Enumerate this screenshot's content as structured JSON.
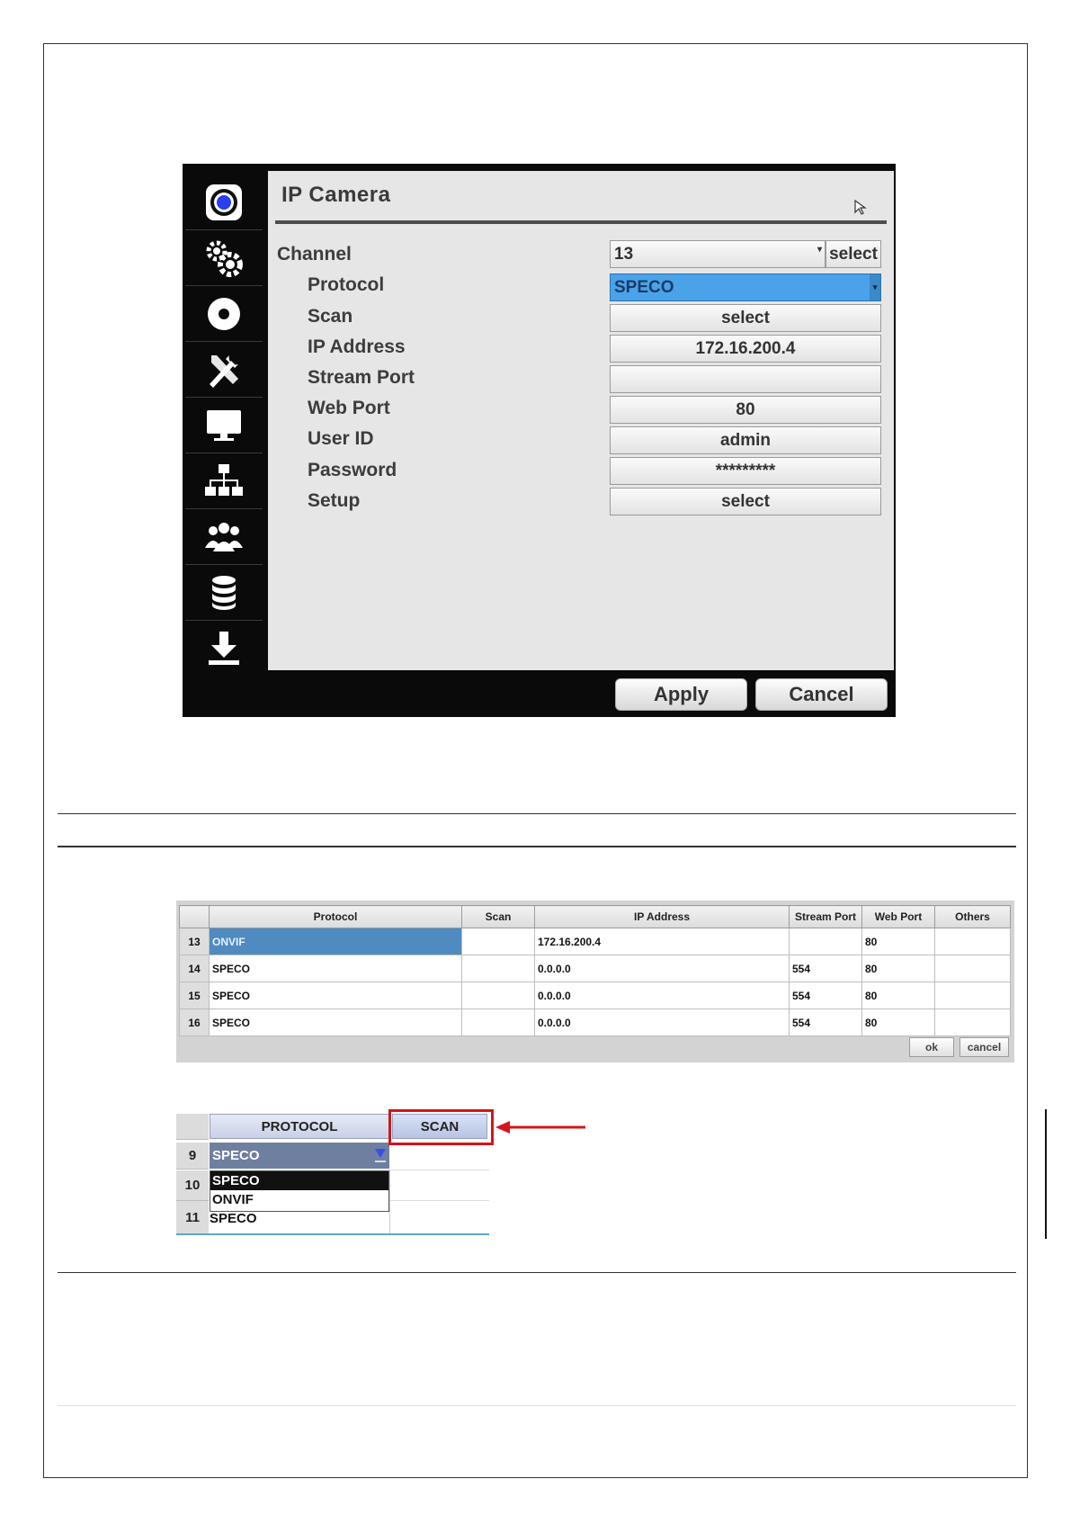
{
  "dialog": {
    "title": "IP Camera",
    "sidebar_icons": [
      "camera-icon",
      "gears-icon",
      "record-disc-icon",
      "tools-icon",
      "monitor-icon",
      "network-icon",
      "users-icon",
      "database-icon",
      "download-icon"
    ],
    "channel": {
      "label": "Channel",
      "value": "13",
      "button": "select"
    },
    "fields": [
      {
        "label": "Protocol",
        "value": "SPECO"
      },
      {
        "label": "Scan",
        "value": "select"
      },
      {
        "label": "IP  Address",
        "value": "172.16.200.4"
      },
      {
        "label": "Stream  Port",
        "value": ""
      },
      {
        "label": "Web  Port",
        "value": "80"
      },
      {
        "label": "User  ID",
        "value": "admin"
      },
      {
        "label": "Password",
        "value": "*********"
      },
      {
        "label": "Setup",
        "value": "select"
      }
    ],
    "apply": "Apply",
    "cancel": "Cancel"
  },
  "table": {
    "headers": [
      "",
      "Protocol",
      "Scan",
      "IP  Address",
      "Stream  Port",
      "Web  Port",
      "Others"
    ],
    "rows": [
      {
        "num": "13",
        "protocol": "ONVIF",
        "scan": "",
        "ip": "172.16.200.4",
        "stream": "",
        "web": "80",
        "others": ""
      },
      {
        "num": "14",
        "protocol": "SPECO",
        "scan": "",
        "ip": "0.0.0.0",
        "stream": "554",
        "web": "80",
        "others": ""
      },
      {
        "num": "15",
        "protocol": "SPECO",
        "scan": "",
        "ip": "0.0.0.0",
        "stream": "554",
        "web": "80",
        "others": ""
      },
      {
        "num": "16",
        "protocol": "SPECO",
        "scan": "",
        "ip": "0.0.0.0",
        "stream": "554",
        "web": "80",
        "others": ""
      }
    ],
    "ok": "ok",
    "cancel": "cancel"
  },
  "crop": {
    "protocol_header": "PROTOCOL",
    "scan_header": "SCAN",
    "rows": [
      "9",
      "10",
      "11"
    ],
    "selected": "SPECO",
    "options": [
      "SPECO",
      "ONVIF"
    ],
    "below": "SPECO",
    "highlight_color": "#d4141b"
  }
}
